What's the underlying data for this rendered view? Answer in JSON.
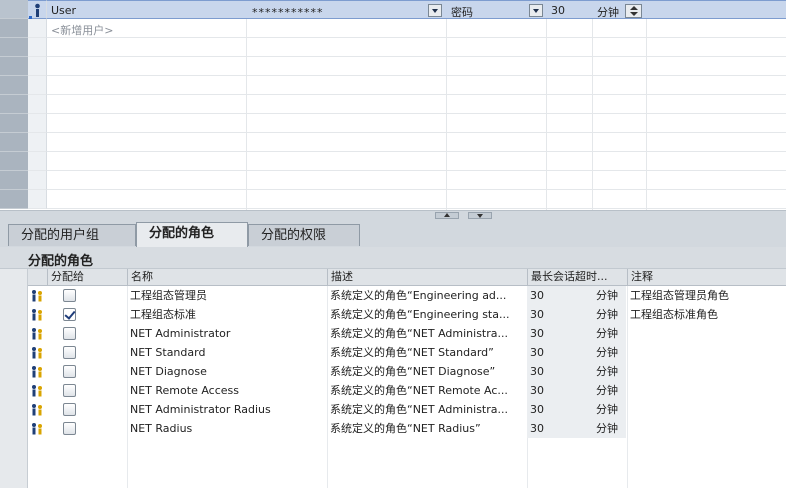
{
  "users_table": {
    "selected_user": {
      "name": "User",
      "password": "***********",
      "auth_method": "密码",
      "timeout_value": "30",
      "timeout_unit": "分钟"
    },
    "add_user_placeholder": "<新增用户>"
  },
  "tabs": [
    {
      "label": "分配的用户组",
      "active": false
    },
    {
      "label": "分配的角色",
      "active": true
    },
    {
      "label": "分配的权限",
      "active": false
    }
  ],
  "roles_pane": {
    "title": "分配的角色",
    "columns": {
      "assign": "分配给",
      "name": "名称",
      "description": "描述",
      "max_timeout": "最长会话超时...",
      "comment": "注释"
    },
    "rows": [
      {
        "assigned": false,
        "name": "工程组态管理员",
        "description": "系统定义的角色“Engineering ad...",
        "timeout": "30",
        "unit": "分钟",
        "comment": "工程组态管理员角色"
      },
      {
        "assigned": true,
        "name": "工程组态标准",
        "description": "系统定义的角色“Engineering sta...",
        "timeout": "30",
        "unit": "分钟",
        "comment": "工程组态标准角色"
      },
      {
        "assigned": false,
        "name": "NET Administrator",
        "description": "系统定义的角色“NET Administra...",
        "timeout": "30",
        "unit": "分钟",
        "comment": ""
      },
      {
        "assigned": false,
        "name": "NET Standard",
        "description": "系统定义的角色“NET Standard”",
        "timeout": "30",
        "unit": "分钟",
        "comment": ""
      },
      {
        "assigned": false,
        "name": "NET Diagnose",
        "description": "系统定义的角色“NET Diagnose”",
        "timeout": "30",
        "unit": "分钟",
        "comment": ""
      },
      {
        "assigned": false,
        "name": "NET Remote Access",
        "description": "系统定义的角色“NET Remote Ac...",
        "timeout": "30",
        "unit": "分钟",
        "comment": ""
      },
      {
        "assigned": false,
        "name": "NET Administrator Radius",
        "description": "系统定义的角色“NET Administra...",
        "timeout": "30",
        "unit": "分钟",
        "comment": ""
      },
      {
        "assigned": false,
        "name": "NET Radius",
        "description": "系统定义的角色“NET Radius”",
        "timeout": "30",
        "unit": "分钟",
        "comment": ""
      }
    ]
  },
  "colors": {
    "selection": "#c8d6ec",
    "gutter": "#aab4bf",
    "tab_bar": "#d2d8de",
    "checkmark": "#1f3d7a"
  }
}
